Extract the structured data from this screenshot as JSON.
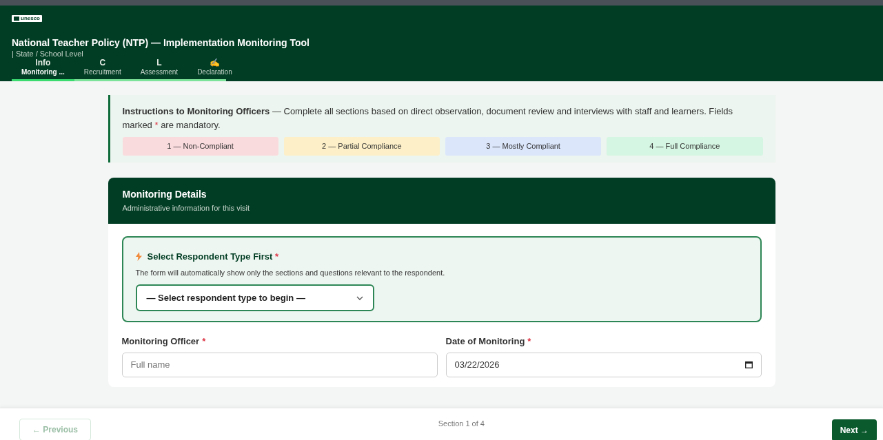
{
  "header": {
    "logo": "unesco",
    "title": "National Teacher Policy (NTP) — Implementation Monitoring Tool",
    "subtitle": "| State / School Level"
  },
  "tabs": [
    {
      "icon": "Info",
      "label": "Monitoring ...",
      "selected": true
    },
    {
      "icon": "C",
      "label": "Recruitment",
      "selected": false
    },
    {
      "icon": "L",
      "label": "Assessment",
      "selected": false
    },
    {
      "icon": "✍",
      "label": "Declaration",
      "selected": false
    }
  ],
  "instructions": {
    "text": "**Instructions to Monitoring Officers** — Complete all sections based on direct observation, document review and interviews with staff and learners. Fields marked * are mandatory.",
    "scale": [
      {
        "label": "1 — Non-Compliant",
        "color": "#fadbdd"
      },
      {
        "label": "2 — Partial Compliance",
        "color": "#fdf0c8"
      },
      {
        "label": "3 — Mostly Compliant",
        "color": "#dbe6fb"
      },
      {
        "label": "4 — Full Compliance",
        "color": "#d5f6e2"
      }
    ]
  },
  "card": {
    "title": "Monitoring Details",
    "subtitle": "Administrative information for this visit",
    "respondent": {
      "title": "Select Respondent Type First",
      "mark": "*",
      "hint": "The form will automatically show only the sections and questions relevant to the respondent.",
      "value": "— Select respondent type to begin —"
    },
    "fields": [
      {
        "label": "Monitoring Officer",
        "mark": "*",
        "kind": "text",
        "placeholder": "Full name"
      },
      {
        "label": "Date of Monitoring",
        "mark": "*",
        "kind": "date",
        "value": "03/22/2026"
      }
    ]
  },
  "footer": {
    "previous": {
      "label": "← Previous",
      "disabled": true
    },
    "section": "Section 1 of 4",
    "next": {
      "label": "Next →",
      "disabled": false
    }
  }
}
